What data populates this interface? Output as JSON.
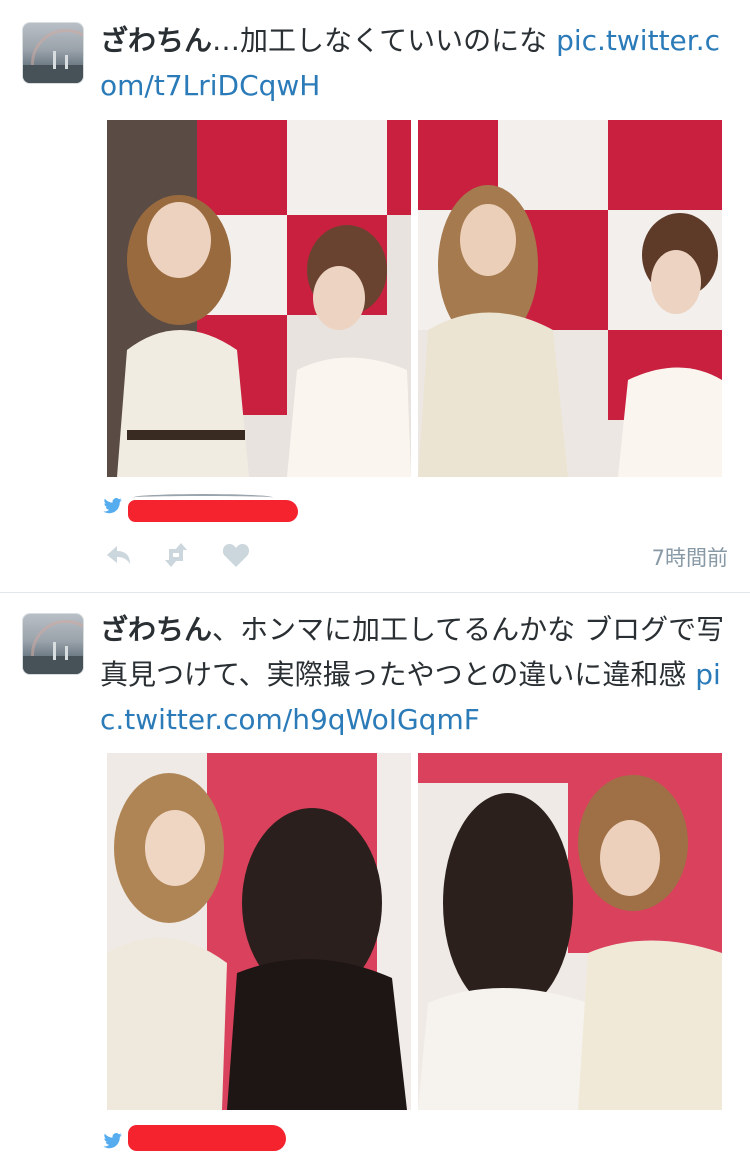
{
  "tweets": [
    {
      "name": "ざわちん",
      "text": "…加工しなくていいのにな ",
      "link": "pic.twitter.com/t7LriDCqwH",
      "timestamp": "7時間前"
    },
    {
      "name": "ざわちん",
      "text": "、ホンマに加工してるんかな ブログで写真見つけて、実際撮ったやつとの違いに違和感 ",
      "link": "pic.twitter.com/h9qWoIGqmF"
    }
  ],
  "colors": {
    "link": "#2b7bb9",
    "text": "#292f33",
    "muted": "#8899a6",
    "redaction": "#f4232e",
    "twitter_blue": "#55acee"
  },
  "icons": [
    "twitter-bird-icon",
    "reply-icon",
    "retweet-icon",
    "favorite-icon"
  ]
}
